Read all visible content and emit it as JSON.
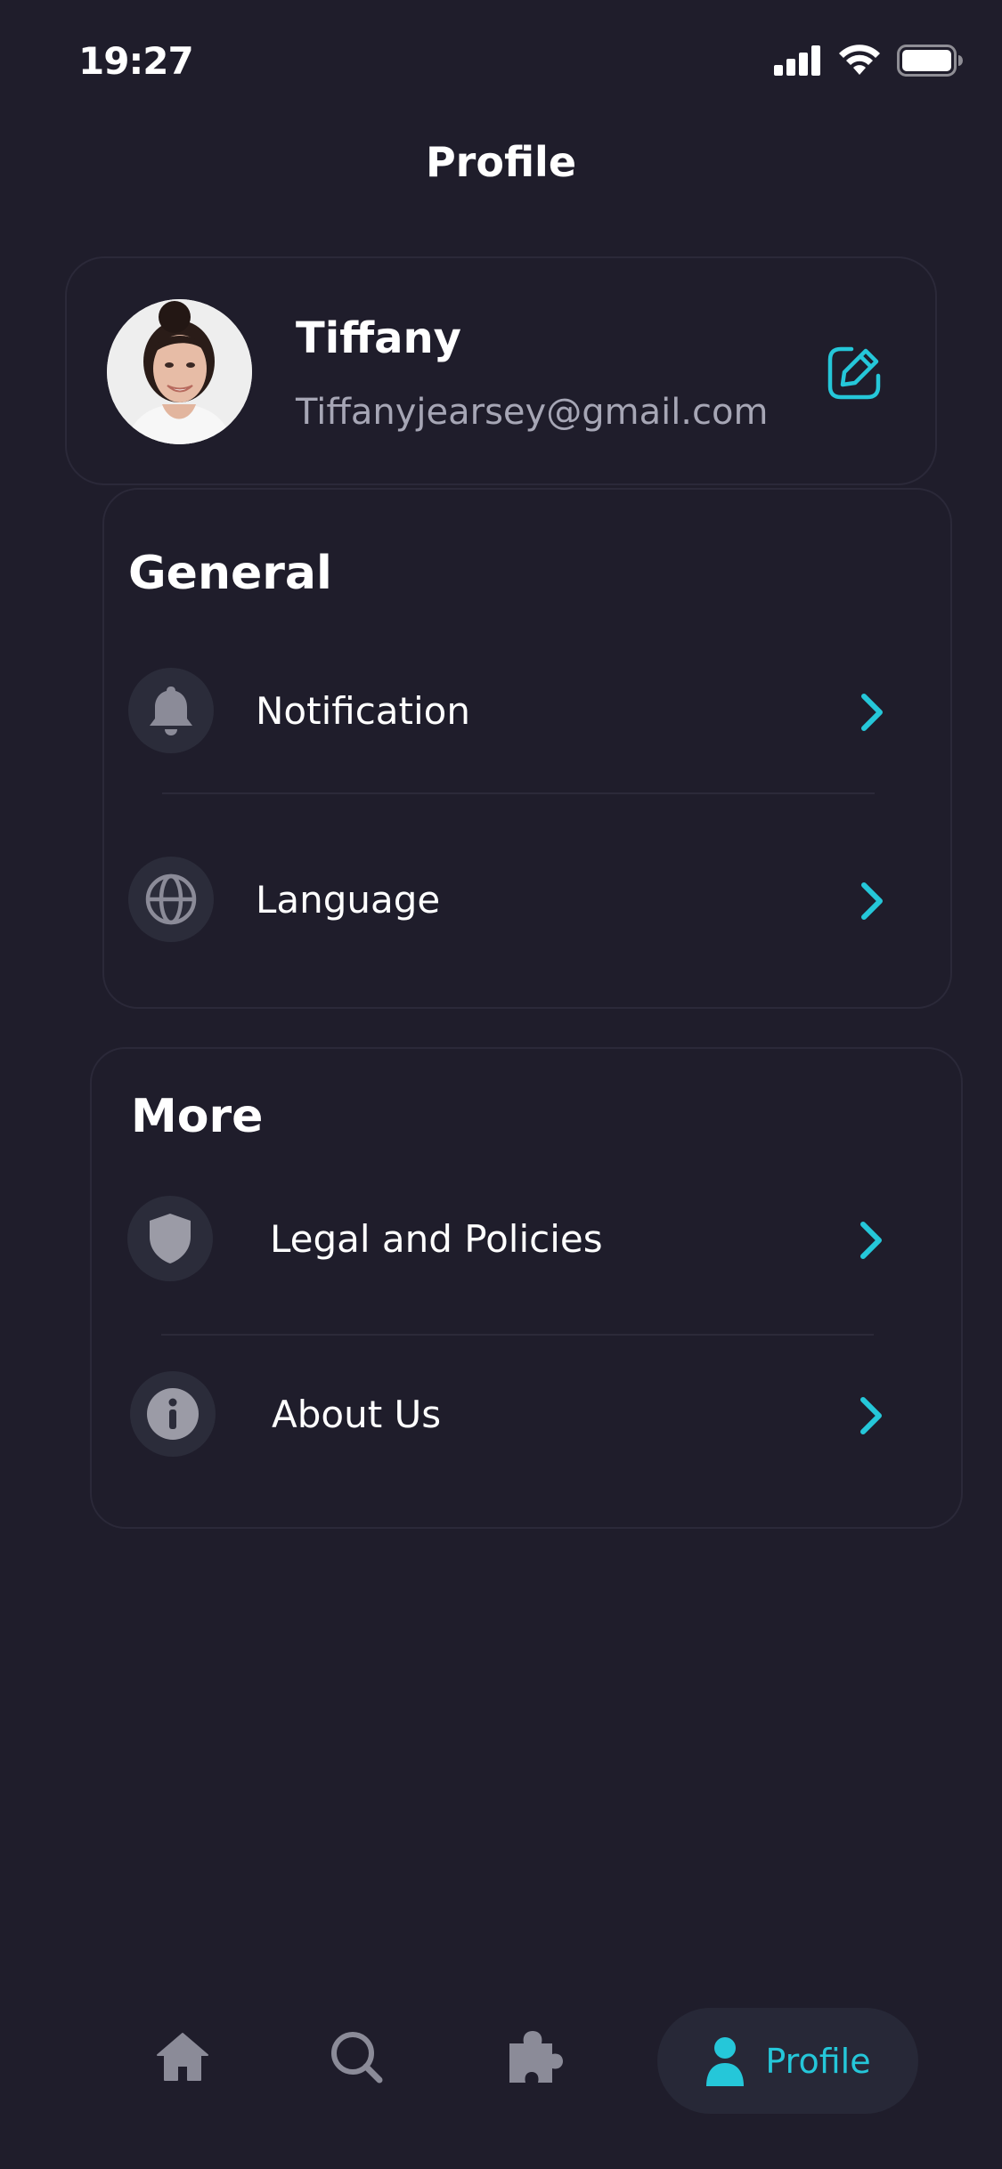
{
  "status_bar": {
    "time": "19:27"
  },
  "header": {
    "title": "Profile"
  },
  "profile": {
    "name": "Tiffany",
    "email": "Tiffanyjearsey@gmail.com"
  },
  "general": {
    "title": "General",
    "items": [
      {
        "label": "Notification",
        "icon": "bell-icon"
      },
      {
        "label": "Language",
        "icon": "globe-icon"
      }
    ]
  },
  "more": {
    "title": "More",
    "items": [
      {
        "label": "Legal and Policies",
        "icon": "shield-icon"
      },
      {
        "label": "About Us",
        "icon": "info-icon"
      }
    ]
  },
  "bottom_nav": {
    "items": [
      {
        "icon": "home-icon"
      },
      {
        "icon": "search-icon"
      },
      {
        "icon": "puzzle-icon"
      },
      {
        "icon": "user-icon",
        "label": "Profile",
        "active": true
      }
    ]
  },
  "colors": {
    "background": "#1f1d2b",
    "accent": "#25c7d9",
    "icon_muted": "#8b8b98",
    "card_border": "#2b2939"
  }
}
